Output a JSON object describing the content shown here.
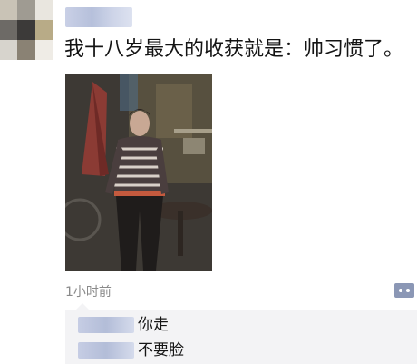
{
  "post": {
    "text": "我十八岁最大的收获就是：帅习惯了。",
    "timestamp": "1小时前"
  },
  "icons": {
    "comment": "comment-dots-icon"
  },
  "comments": [
    {
      "text": "你走"
    },
    {
      "text": "不要脸"
    }
  ],
  "colors": {
    "link_blue": "#8b97b5",
    "comment_bg": "#f3f3f5"
  }
}
